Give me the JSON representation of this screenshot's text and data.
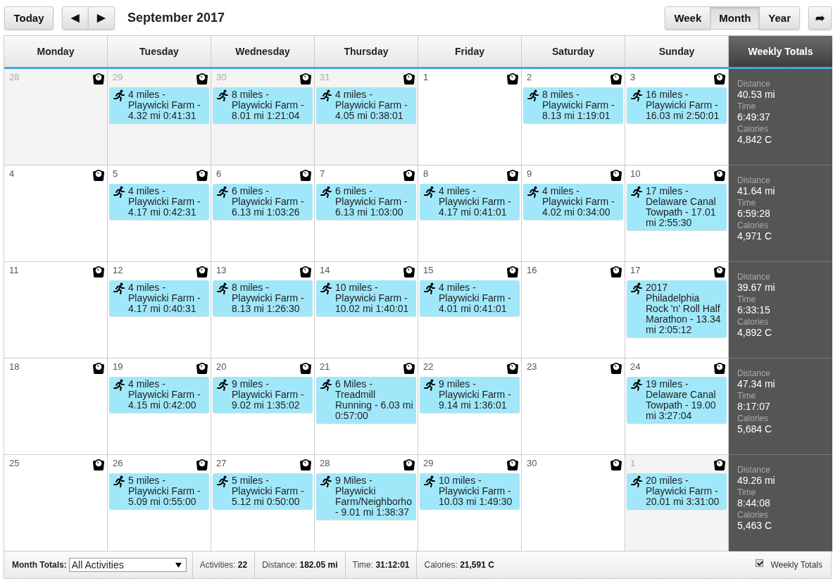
{
  "toolbar": {
    "today": "Today",
    "prev": "◀",
    "next": "▶",
    "title": "September 2017",
    "views": [
      {
        "label": "Week",
        "selected": false
      },
      {
        "label": "Month",
        "selected": true
      },
      {
        "label": "Year",
        "selected": false
      }
    ],
    "share": "➦"
  },
  "columns": [
    "Monday",
    "Tuesday",
    "Wednesday",
    "Thursday",
    "Friday",
    "Saturday",
    "Sunday"
  ],
  "totals_header": "Weekly Totals",
  "weeks": [
    {
      "days": [
        {
          "date": "28",
          "outside": true
        },
        {
          "date": "29",
          "outside": true,
          "events": [
            "4 miles - Playwicki Farm - 4.32 mi 0:41:31"
          ]
        },
        {
          "date": "30",
          "outside": true,
          "events": [
            "8 miles - Playwicki Farm - 8.01 mi 1:21:04"
          ]
        },
        {
          "date": "31",
          "outside": true,
          "events": [
            "4 miles - Playwicki Farm - 4.05 mi 0:38:01"
          ]
        },
        {
          "date": "1",
          "outside": false
        },
        {
          "date": "2",
          "outside": false,
          "events": [
            "8 miles - Playwicki Farm - 8.13 mi 1:19:01"
          ]
        },
        {
          "date": "3",
          "outside": false,
          "events": [
            "16 miles - Playwicki Farm - 16.03 mi 2:50:01"
          ]
        }
      ],
      "totals": [
        {
          "label": "Distance",
          "value": "40.53 mi"
        },
        {
          "label": "Time",
          "value": "6:49:37"
        },
        {
          "label": "Calories",
          "value": "4,842 C"
        }
      ]
    },
    {
      "days": [
        {
          "date": "4",
          "outside": false
        },
        {
          "date": "5",
          "outside": false,
          "events": [
            "4 miles - Playwicki Farm - 4.17 mi 0:42:31"
          ]
        },
        {
          "date": "6",
          "outside": false,
          "events": [
            "6 miles - Playwicki Farm - 6.13 mi 1:03:26"
          ]
        },
        {
          "date": "7",
          "outside": false,
          "events": [
            "6 miles - Playwicki Farm - 6.13 mi 1:03:00"
          ]
        },
        {
          "date": "8",
          "outside": false,
          "events": [
            "4 miles - Playwicki Farm - 4.17 mi 0:41:01"
          ]
        },
        {
          "date": "9",
          "outside": false,
          "events": [
            "4 miles - Playwicki Farm - 4.02 mi 0:34:00"
          ]
        },
        {
          "date": "10",
          "outside": false,
          "events": [
            "17 miles - Delaware Canal Towpath - 17.01 mi 2:55:30"
          ]
        }
      ],
      "totals": [
        {
          "label": "Distance",
          "value": "41.64 mi"
        },
        {
          "label": "Time",
          "value": "6:59:28"
        },
        {
          "label": "Calories",
          "value": "4,971 C"
        }
      ]
    },
    {
      "days": [
        {
          "date": "11",
          "outside": false
        },
        {
          "date": "12",
          "outside": false,
          "events": [
            "4 miles - Playwicki Farm - 4.17 mi 0:40:31"
          ]
        },
        {
          "date": "13",
          "outside": false,
          "events": [
            "8 miles - Playwicki Farm - 8.13 mi 1:26:30"
          ]
        },
        {
          "date": "14",
          "outside": false,
          "events": [
            "10 miles - Playwicki Farm - 10.02 mi 1:40:01"
          ]
        },
        {
          "date": "15",
          "outside": false,
          "events": [
            "4 miles - Playwicki Farm - 4.01 mi 0:41:01"
          ]
        },
        {
          "date": "16",
          "outside": false
        },
        {
          "date": "17",
          "outside": false,
          "events": [
            "2017 Philadelphia Rock 'n' Roll Half Marathon - 13.34 mi 2:05:12"
          ]
        }
      ],
      "totals": [
        {
          "label": "Distance",
          "value": "39.67 mi"
        },
        {
          "label": "Time",
          "value": "6:33:15"
        },
        {
          "label": "Calories",
          "value": "4,892 C"
        }
      ]
    },
    {
      "days": [
        {
          "date": "18",
          "outside": false
        },
        {
          "date": "19",
          "outside": false,
          "events": [
            "4 miles - Playwicki Farm - 4.15 mi 0:42:00"
          ]
        },
        {
          "date": "20",
          "outside": false,
          "events": [
            "9 miles - Playwicki Farm - 9.02 mi 1:35:02"
          ]
        },
        {
          "date": "21",
          "outside": false,
          "events": [
            "6 Miles - Treadmill Running - 6.03 mi 0:57:00"
          ]
        },
        {
          "date": "22",
          "outside": false,
          "events": [
            "9 miles - Playwicki Farm - 9.14 mi 1:36:01"
          ]
        },
        {
          "date": "23",
          "outside": false
        },
        {
          "date": "24",
          "outside": false,
          "events": [
            "19 miles - Delaware Canal Towpath - 19.00 mi 3:27:04"
          ]
        }
      ],
      "totals": [
        {
          "label": "Distance",
          "value": "47.34 mi"
        },
        {
          "label": "Time",
          "value": "8:17:07"
        },
        {
          "label": "Calories",
          "value": "5,684 C"
        }
      ]
    },
    {
      "days": [
        {
          "date": "25",
          "outside": false
        },
        {
          "date": "26",
          "outside": false,
          "events": [
            "5 miles - Playwicki Farm - 5.09 mi 0:55:00"
          ]
        },
        {
          "date": "27",
          "outside": false,
          "events": [
            "5 miles - Playwicki Farm - 5.12 mi 0:50:00"
          ]
        },
        {
          "date": "28",
          "outside": false,
          "events": [
            "9 Miles - Playwicki Farm/Neighborho - 9.01 mi 1:38:37"
          ]
        },
        {
          "date": "29",
          "outside": false,
          "events": [
            "10 miles - Playwicki Farm - 10.03 mi 1:49:30"
          ]
        },
        {
          "date": "30",
          "outside": false
        },
        {
          "date": "1",
          "outside": true,
          "events": [
            "20 miles - Playwicki Farm - 20.01 mi 3:31:00"
          ]
        }
      ],
      "totals": [
        {
          "label": "Distance",
          "value": "49.26 mi"
        },
        {
          "label": "Time",
          "value": "8:44:08"
        },
        {
          "label": "Calories",
          "value": "5,463 C"
        }
      ]
    }
  ],
  "footer": {
    "label": "Month Totals:",
    "filter": "All Activities",
    "stats": [
      {
        "label": "Activities:",
        "value": "22"
      },
      {
        "label": "Distance:",
        "value": "182.05 mi"
      },
      {
        "label": "Time:",
        "value": "31:12:01"
      },
      {
        "label": "Calories:",
        "value": "21,591 C"
      }
    ],
    "weekly_totals": {
      "label": "Weekly Totals",
      "checked": true
    }
  }
}
